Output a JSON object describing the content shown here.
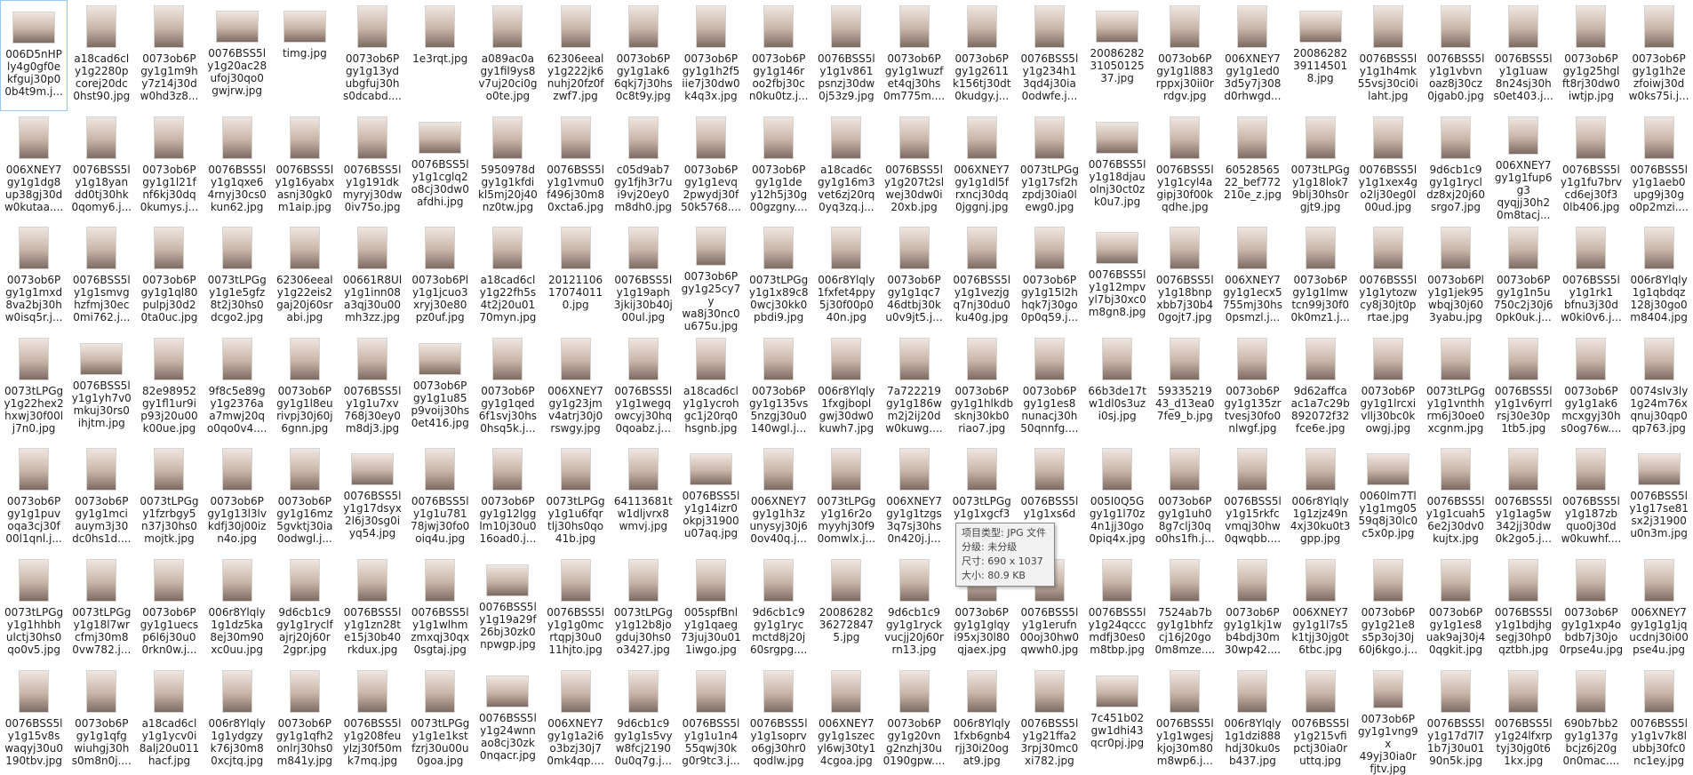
{
  "files": [
    {
      "name": "006D5nHP\nly4g0gf0e\nkfguj30p0\n0b4t9m.j...",
      "orientation": "landscape",
      "selected": true
    },
    {
      "name": "a18cad6cl\ny1g2280p\ncorej20dc\n0hst90.jpg"
    },
    {
      "name": "0073ob6P\ngy1g1m9h\ny7z14j30d\nw0hd3z8..."
    },
    {
      "name": "0076BSS5l\ny1g20ac28\nufoj30qo0\ngwjrw.jpg",
      "orientation": "landscape"
    },
    {
      "name": "timg.jpg",
      "orientation": "landscape"
    },
    {
      "name": "0073ob6P\ngy1g13yd\nubgfuj30h\ns0dcabd...."
    },
    {
      "name": "1e3rqt.jpg"
    },
    {
      "name": "a089ac0a\ngy1fil9ys8\nv7uj20ci0g\no0te.jpg"
    },
    {
      "name": "62306eeal\ny1g222jk6\nnuhj20fz0f\nzwf7.jpg"
    },
    {
      "name": "0073ob6P\ngy1g1ak6\n6qkj7j30hs\n0c8t9y.jpg"
    },
    {
      "name": "0073ob6P\ngy1g1h2f5\niie7j30dw0\nk4q3x.jpg"
    },
    {
      "name": "0073ob6P\ngy1g146r\noo2fbj30c\nn0ku0tz.j..."
    },
    {
      "name": "0076BSS5l\ny1g1v861\npsnzj30dw\n0j53z9.jpg"
    },
    {
      "name": "0073ob6P\ngy1g1wuzf\net4qj30hs\n0m775m...."
    },
    {
      "name": "0073ob6P\ngy1g2611\nk156tj30dt\n0kudgy.j..."
    },
    {
      "name": "0076BSS5l\ny1g234h1\n3qd4j30ia\n0odwfe.j..."
    },
    {
      "name": "20086282\n31050125\n37.jpg",
      "orientation": "landscape"
    },
    {
      "name": "0073ob6P\ngy1g1l883\nrppxj30ii0r\nrdgv.jpg"
    },
    {
      "name": "006XNEY7\ngy1g1ed0\n3d5y7j308\nd0rhwgd..."
    },
    {
      "name": "20086282\n39114501\n8.jpg",
      "orientation": "landscape"
    },
    {
      "name": "0076BSS5l\ny1g1h4mk\n55vsj30ci0i\nlaht.jpg"
    },
    {
      "name": "0076BSS5l\ny1g1vbvn\noaz8j30cz\n0jgab0.jpg"
    },
    {
      "name": "0076BSS5l\ny1g1uaw\n8n24sj30h\ns0et403.j..."
    },
    {
      "name": "0073ob6P\ngy1g25hgl\nft8rj30dw0\niwtjp.jpg"
    },
    {
      "name": "0073ob6P\ngy1g1h2e\nzfoiwj30d\nw0ks75i.j..."
    },
    {
      "name": "006XNEY7\ngy1g1dg8\nup38gj30d\nw0kutaa...."
    },
    {
      "name": "0076BSS5l\ny1g18yan\ndd0tj30hk\n0qomy6.j..."
    },
    {
      "name": "0073ob6P\ngy1g1l21f\nnf6kj30dq\n0kumys.j..."
    },
    {
      "name": "0076BSS5l\ny1g1qxe6\n4rnyj30cs0\nkun62.jpg"
    },
    {
      "name": "0076BSS5l\ny1g16yabx\nasnj30gk0\nm1aip.jpg"
    },
    {
      "name": "0076BSS5l\ny1g191dk\nmyryj30dw\n0iv75o.jpg"
    },
    {
      "name": "0076BSS5l\ny1g1cglq2\no8cj30dw0\nafdhi.jpg",
      "orientation": "landscape"
    },
    {
      "name": "5950978d\ngy1g1kfdi\nkl5mj20j40\nnz0tw.jpg"
    },
    {
      "name": "0076BSS5l\ny1g1vmu0\nf496j30m8\n0xcta6.jpg"
    },
    {
      "name": "c05d9ab7\ngy1fjh3r7u\ni9vj20ey0\nm8dh0.jpg"
    },
    {
      "name": "0073ob6P\ngy1g1evq\n2pwydj30f\n50k5768...."
    },
    {
      "name": "0073ob6P\ngy1g1de\ny12h5j30g\n00gzgny...."
    },
    {
      "name": "a18cad6c\ngy1g16m3\nvet6zj20rq\n0yq3zq.j..."
    },
    {
      "name": "0076BSS5l\ny1g207t2sl\nwej30dw0i\n20xb.jpg"
    },
    {
      "name": "006XNEY7\ngy1g1dl5f\nrxncj30dq\n0jggnj.jpg"
    },
    {
      "name": "0073tLPGg\ny1g17sf2h\nzpdj30ia0l\newg0.jpg"
    },
    {
      "name": "0076BSS5l\ny1g18djau\nolnj30ct0z\nk0u7.jpg",
      "orientation": "landscape"
    },
    {
      "name": "0076BSS5l\ny1g1cyl4a\ngipj30f00k\nqdhe.jpg"
    },
    {
      "name": "60528565\n22_bef772\n210e_z.jpg"
    },
    {
      "name": "0073tLPGg\ny1g18lok7\n9blj30hs0r\ngjt9.jpg"
    },
    {
      "name": "0076BSS5l\ny1g1xex4g\no2lj30eg0l\n00ud.jpg"
    },
    {
      "name": "9d6cb1c9\ngy1g1rycl\ndz8xj20j60\nsrgo7.jpg"
    },
    {
      "name": "006XNEY7\ngy1g1fup6g3\nqyqjj30h2\n0m8tacj..."
    },
    {
      "name": "0076BSS5l\ny1g1fu7brv\ncd6ej30f3\n0lb406.jpg"
    },
    {
      "name": "0076BSS5l\ny1g1aeb0\nupg9j30g\no0p2mzi...."
    },
    {
      "name": "0073ob6P\ngy1g1mxd\n8va2bj30h\nw0isq5r.j..."
    },
    {
      "name": "0076BSS5l\ny1g1smvg\nhzfmj30ec\n0mi762.j..."
    },
    {
      "name": "0073ob6P\ngy1g1ql80\npulpj30d2\n0ta0uc.jpg"
    },
    {
      "name": "0073tLPGg\ny1g1e5gfz\n8t2j30hs0\ndcgo2.jpg"
    },
    {
      "name": "62306eeal\ny1g22eis2\ngaj20j60sr\nabi.jpg"
    },
    {
      "name": "00661R8Ul\ny1g1inn08\na3qj30u00\nmh3zz.jpg"
    },
    {
      "name": "0073ob6Pl\ny1g1jcuo3\nxryj30e80\npz0uf.jpg"
    },
    {
      "name": "a18cad6cl\ny1g22fh5s\n4t2j20u01\n70myn.jpg"
    },
    {
      "name": "20121106\n17074011\n0.jpg"
    },
    {
      "name": "0076BSS5l\ny1g19aph\n3jkij30b40j\n00ul.jpg"
    },
    {
      "name": "0073ob6P\ngy1g25cy7y\nwa8j30nc0\nu675u.jpg"
    },
    {
      "name": "0073tLPGg\ny1g1x89c8\n0wcj30kk0\npbdi9.jpg"
    },
    {
      "name": "006r8Ylqly\n1fxfet4ppy\n5j30f00p0\n40n.jpg"
    },
    {
      "name": "0073ob6P\ngy1g1qc7\n46dtbj30k\nu0v9jt5.j..."
    },
    {
      "name": "0076BSS5l\ny1g1vezjg\nq7nj30du0\nku40g.jpg"
    },
    {
      "name": "0073ob6P\ngy1g15l2h\nhqk7j30go\n0p0q59.j..."
    },
    {
      "name": "0076BSS5l\ny1g12mpv\nyl7bj30xc0\nm8gn8.jpg",
      "orientation": "landscape"
    },
    {
      "name": "0076BSS5l\ny1g18bnp\nxbb7j30b4\n0gojt7.jpg"
    },
    {
      "name": "006XNEY7\ngy1g1ecx5\n755mj30hs\n0psmzl.j..."
    },
    {
      "name": "0073ob6P\ngy1g1lmw\ntcn99j30f0\n0k0mz1.j..."
    },
    {
      "name": "0076BSS5l\ny1g1ytozw\ncy8j30jt0p\nrtae.jpg"
    },
    {
      "name": "0073ob6Pl\ny1g1jek95\nwbqj30j60\n3yabu.jpg"
    },
    {
      "name": "0073ob6P\ngy1g1n5u\n750c2j30j6\n0pk0uk.j..."
    },
    {
      "name": "0076BSS5l\ny1g1rk1\nbfnu3j30d\nw0ki0v6.j..."
    },
    {
      "name": "006r8Ylqly\n1g1qbdqz\n128j30go0\nm8404.jpg"
    },
    {
      "name": "0073tLPGg\ny1g22hex2\nhxwj30f00l\nj7n0.jpg"
    },
    {
      "name": "0076BSS5l\ny1g1yh7v0\nmkuj30rs0\nihjtm.jpg",
      "orientation": "landscape"
    },
    {
      "name": "82e98952\ngy1fl1ur9i\np93j20u00\nk00ue.jpg"
    },
    {
      "name": "9f8c5e89g\ny1g2376a\na7mwj20q\no0qo0v4...."
    },
    {
      "name": "0073ob6P\ngy1g1l8eu\nrivpj30j60j\n6gnn.jpg"
    },
    {
      "name": "0076BSS5l\ny1g1u7xv\n768j30ey0\nm8dj3.jpg"
    },
    {
      "name": "0073ob6P\ngy1g1u85\np9voij30hs\n0et416.jpg",
      "orientation": "landscape"
    },
    {
      "name": "0073ob6P\ngy1g1qed\n6f1svj30hs\n0hsq5k.j..."
    },
    {
      "name": "006XNEY7\ngy1g23jm\nv4atrj30j0\nrswgy.jpg"
    },
    {
      "name": "0076BSS5l\ny1g1wegq\nowcyj30hq\n0qoabz.j..."
    },
    {
      "name": "a18cad6cl\ny1g1ycroh\ngc1j20rq0\nhsgnb.jpg"
    },
    {
      "name": "0073ob6P\ngy1g135vs\n5nzgj30u0\n140wgl.j..."
    },
    {
      "name": "006r8Ylqly\n1fxgjbopl\ngwj30dw0\nkuwh7.jpg"
    },
    {
      "name": "7a722219\ngy1g186w\nm2j2ij20d\nw0kuwg...."
    },
    {
      "name": "0073ob6P\ngy1g1hlkdb\nsknj30kb0\nriao7.jpg"
    },
    {
      "name": "0073ob6P\ngy1g1es8\nnunacj30h\n50qnnfg...."
    },
    {
      "name": "66b3de17t\nw1dl0s3uz\ni0sj.jpg"
    },
    {
      "name": "59335219\n43_d13ea0\n7fe9_b.jpg"
    },
    {
      "name": "0073ob6P\ngy1g135zr\ntvesj30fo0\nnlwgf.jpg"
    },
    {
      "name": "9d62affca\nac1a7c29b\n892072f32\nfce6e.jpg"
    },
    {
      "name": "0073ob6P\ngy1g1lrcxi\nvllj30bc0k\nowgj.jpg"
    },
    {
      "name": "0073tLPGg\ny1g1vnthh\nrm6j30oe0\nxcgnm.jpg"
    },
    {
      "name": "0076BSS5l\ny1g1v6yrrl\nrsj30e30p\n1tb5.jpg"
    },
    {
      "name": "0073ob6P\ngy1g1ak6\nmcxgyj30h\ns0og76w...."
    },
    {
      "name": "0074sIv3ly\n1g24m76x\nqnuj30qp0\nqp763.jpg"
    },
    {
      "name": "0073ob6P\ngy1g1puv\noqa3cj30f\n00l1qnl.j..."
    },
    {
      "name": "0073ob6P\ngy1g1mci\nauym3j30\ndc0hs1d...."
    },
    {
      "name": "0073tLPGg\ny1fzrbgy5\nn37j30hs0\nmojtk.jpg"
    },
    {
      "name": "0073ob6P\ngy1g13l3lv\nkdfj30j00iz\nn4o.jpg"
    },
    {
      "name": "0073ob6P\ngy1g16mz\n5gvktj30ia\n0odwgl.j..."
    },
    {
      "name": "0076BSS5l\ny1g17dsyx\n2l6j30sg0i\nyq54.jpg",
      "orientation": "landscape"
    },
    {
      "name": "0076BSS5l\ny1g1u781\n78jwj30fo0\noiq4u.jpg"
    },
    {
      "name": "0073ob6P\ngy1g12lgg\nlm10j30u0\n16oad0.j..."
    },
    {
      "name": "0073tLPGg\ny1g1u6fqr\ntlj30hs0qo\n41b.jpg"
    },
    {
      "name": "64113681t\nw1dljvrx8\nwmvj.jpg"
    },
    {
      "name": "0076BSS5l\ny1g14izr0\nokpj31900\nu07aq.jpg",
      "orientation": "landscape"
    },
    {
      "name": "006XNEY7\ngy1g1h3z\nunysyj30j6\n0ov40q.j..."
    },
    {
      "name": "0073tLPGg\ny1g16r2o\nmyyhj30f9\n0omwlx.j..."
    },
    {
      "name": "006XNEY7\ngy1g1tzgs\n3q7sj30hs\n0n420j.j..."
    },
    {
      "name": "0073tLPGg\ny1g1xgcf3"
    },
    {
      "name": "0076BSS5l\ny1g1xs6d"
    },
    {
      "name": "005I0Q5G\ngy1g1l70z\n4n1jj30go\n0piq4x.jpg"
    },
    {
      "name": "0073ob6P\ngy1g1uh0\n8g7clj30q\no0hs1fh.j..."
    },
    {
      "name": "0076BSS5l\ny1g15rkfc\nvmqj30hw\n0qwqbb...."
    },
    {
      "name": "006r8Ylqly\n1g1zjz49n\n4xj30ku0t3\ngpp.jpg"
    },
    {
      "name": "0060lm7Tl\ny1g1mg05\n59q8j30lc0\nc5x0p.jpg",
      "orientation": "landscape"
    },
    {
      "name": "0076BSS5l\ny1g1cuah5\n6e2j30dv0\nkujtx.jpg"
    },
    {
      "name": "0076BSS5l\ny1g1ag5w\n342jj30dw\n0k2go5.j..."
    },
    {
      "name": "0076BSS5l\ny1g187zb\nquo0j30d\nw0kuwhf...."
    },
    {
      "name": "0076BSS5l\ny1g17se81\nsx2j31900\nu0n3m.jpg",
      "orientation": "landscape"
    },
    {
      "name": "0073tLPGg\ny1g1hhbh\nulctj30hs0\nqo0v5.jpg"
    },
    {
      "name": "0073tLPGg\ny1g18l7wr\ncfmj30m8\n0vw782.j..."
    },
    {
      "name": "0073ob6P\ngy1g1uecs\np6l6j30u0\n0rkn0w.j..."
    },
    {
      "name": "006r8Ylqly\n1g1dz5ka\n8ej30m90\nxc0uu.jpg"
    },
    {
      "name": "9d6cb1c9\ngy1g1ryclf\najrj20j60r\n2gpr.jpg"
    },
    {
      "name": "0076BSS5l\ny1g1zn28t\ne15j30b40\nrkdux.jpg"
    },
    {
      "name": "0076BSS5l\ny1g1wlhm\nzmxqj30qx\n0sgtaj.jpg"
    },
    {
      "name": "0076BSS5l\ny1g19a29f\n26bj30zk0\nnpwgp.jpg",
      "orientation": "landscape"
    },
    {
      "name": "0076BSS5l\ny1g1g0mc\nrtqpj30u0\n11hjto.jpg"
    },
    {
      "name": "0073tLPGg\ny1g12b8jo\ngduj30hs0\no3427.jpg"
    },
    {
      "name": "005spfBnl\ny1g1qaeg\n73juj30u01\n1iwgo.jpg"
    },
    {
      "name": "9d6cb1c9\ngy1g1ryc\nmctd8j20j\n60srgpg...."
    },
    {
      "name": "20086282\n36272847\n5.jpg"
    },
    {
      "name": "9d6cb1c9\ngy1g1ryck\nvucjj20j60r\nrn13.jpg"
    },
    {
      "name": "0073ob6P\ngy1g1glqy\ni95xj30l80\nqjaex.jpg"
    },
    {
      "name": "0076BSS5l\ny1g1erufn\n00oj30hw0\nqwwh0.jpg"
    },
    {
      "name": "0076BSS5l\ny1g24qccc\nmdfj30es0\nm8tbp.jpg"
    },
    {
      "name": "7524ab7b\ngy1g1bhfz\ncj16j20go\n0m8mze...."
    },
    {
      "name": "0073ob6P\ngy1g1kj1w\nb4bdj30m\n30wp42...."
    },
    {
      "name": "006XNEY7\ngy1g1l7s5\nk1tjj30jg0t\n6tbc.jpg"
    },
    {
      "name": "0073ob6P\ngy1g21e8\ns5p3oj30j\n60j6kgo.j..."
    },
    {
      "name": "0073ob6P\ngy1g1es8\nuak9aj30j4\n0qgkit.jpg"
    },
    {
      "name": "0076BSS5l\ny1g1bdjhg\nsegj30hp0\nqztbh.jpg"
    },
    {
      "name": "0073ob6P\ngy1g1xp4o\nbdb7j30jo\n0rpse4u.jpg"
    },
    {
      "name": "006XNEY7\ngy1g1g1jq\nucdnj30i00\npse4u.jpg"
    },
    {
      "name": "0076BSS5l\ny1g15v8s\nwaqyj30u0\n190tbv.jpg"
    },
    {
      "name": "0073ob6P\ngy1g1qfg\nwiuhgj30h\ns0m8n0j...."
    },
    {
      "name": "a18cad6cl\ny1g1ycv0i\n8alj20u011\nhacf.jpg"
    },
    {
      "name": "006r8Ylqly\n1g1ydgzy\nk76j30m8\n0xcjtq.jpg"
    },
    {
      "name": "0073ob6P\ngy1g1qfh2\nonlrj30hs0\nm841y.jpg"
    },
    {
      "name": "0076BSS5l\ny1g208feu\nylzj30f50m\nk7mq.jpg"
    },
    {
      "name": "0073tLPGg\ny1g1e1kst\nfzrj30u00u\n0goa.jpg"
    },
    {
      "name": "0076BSS5l\ny1g24wnn\nao8cj30zk\n0nqacr.jpg",
      "orientation": "landscape"
    },
    {
      "name": "006XNEY7\ngy1g1a2i6\no3bzj30j7\n0mk4qp...."
    },
    {
      "name": "9d6cb1c9\ngy1g1s5vy\nw8fcj2190\n0u0q7g.j..."
    },
    {
      "name": "0076BSS5l\ny1g1u1n4\n55qwj30k\ng0r9tc3.j..."
    },
    {
      "name": "0076BSS5l\ny1g1soprv\no6gj30hr0\nqodlw.jpg"
    },
    {
      "name": "006XNEY7\ngy1g1szec\nyl6wj30ty1\n4cgoa.jpg"
    },
    {
      "name": "0073ob6P\ngy1g20vn\ng2nzhj30u\n0190gpw...."
    },
    {
      "name": "006r8Ylqly\n1fxb6gnb4\nrjj30i20og\nat9.jpg"
    },
    {
      "name": "0076BSS5l\ny1g21ffa2\n3rpj30mc0\nxi782.jpg"
    },
    {
      "name": "7c451b02\ngw1dhi43\nqcr0pj.jpg",
      "orientation": "landscape"
    },
    {
      "name": "0076BSS5l\ny1g1wgesj\nkjoj30m80\nm8wp6.j..."
    },
    {
      "name": "006r8Ylqly\n1g1dzi888\nhdj30ku0s\nb437.jpg"
    },
    {
      "name": "0076BSS5l\ny1g215vfi\npctj30ia0r\nuttq.jpg"
    },
    {
      "name": "0073ob6P\ngy1g1vng9x\n49yj30ia0r\nfjtv.jpg"
    },
    {
      "name": "0076BSS5l\ny1g17d7l7\n1b7j30u01\n90n5k.jpg"
    },
    {
      "name": "0076BSS5l\ny1g24lfxrp\ntyj30jg0t6\n1kx.jpg"
    },
    {
      "name": "690b7bb2\ngy1g137g\nbcjz6j20g\n0n0mac...."
    },
    {
      "name": "0076BSS5l\ny1g1v7k8l\nubbj30fc0\nnc1ey.jpg"
    }
  ],
  "tooltip": {
    "line1": "项目类型: JPG 文件",
    "line2": "分级: 未分级",
    "line3": "尺寸: 690 x 1037",
    "line4": "大小: 80.9 KB"
  }
}
